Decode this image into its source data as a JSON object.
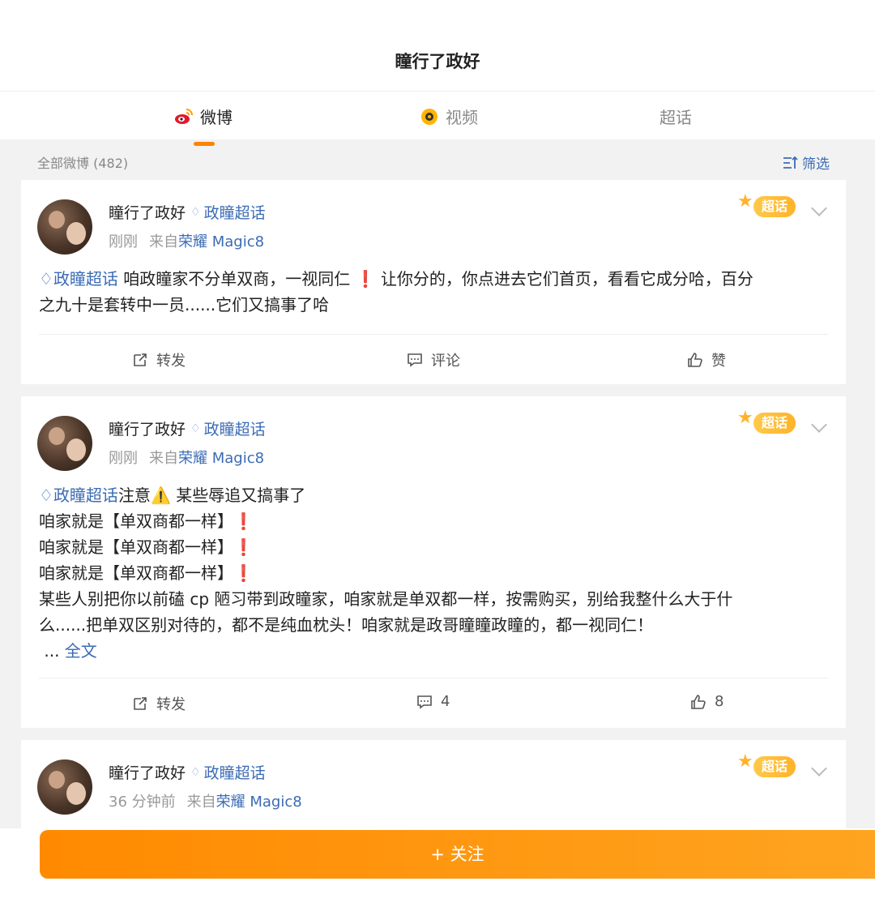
{
  "header": {
    "title": "瞳行了政好"
  },
  "tabs": [
    {
      "label": "微博",
      "icon": "weibo-icon"
    },
    {
      "label": "视频",
      "icon": "video-icon"
    },
    {
      "label": "超话",
      "icon": ""
    }
  ],
  "filter": {
    "count": "全部微博 (482)",
    "label": "筛选"
  },
  "posts": [
    {
      "username": "瞳行了政好",
      "topic": "政瞳超话",
      "time": "刚刚",
      "source": "来自",
      "device": "荣耀 Magic8",
      "badge": "超话",
      "text_topic": "政瞳超话",
      "text1": " 咱政瞳家不分单双商，一视同仁",
      "text_mark": "❗",
      "text2": " 让你分的，你点进去它们首页，看看它成分哈，百分",
      "text3": "之九十是套转中一员......它们又搞事了哈",
      "repost": "转发",
      "comment": "评论",
      "like": "赞"
    },
    {
      "username": "瞳行了政好",
      "topic": "政瞳超话",
      "time": "刚刚",
      "source": "来自",
      "device": "荣耀 Magic8",
      "badge": "超话",
      "text_topic": "政瞳超话",
      "line1": "注意",
      "line1_warn": "⚠️",
      "line1_tail": " 某些辱追又搞事了",
      "line2": "咱家就是【单双商都一样】",
      "mark": "❗",
      "line5": "某些人别把你以前磕 cp 陋习带到政瞳家，咱家就是单双都一样，按需购买，别给我整什么大于什",
      "line6": "么......把单双区别对待的，都不是纯血枕头！咱家就是政哥瞳瞳政瞳的，都一视同仁！",
      "more_prefix": "...",
      "more": "全文",
      "repost": "转发",
      "comment": "4",
      "like": "8"
    },
    {
      "username": "瞳行了政好",
      "topic": "政瞳超话",
      "time": "36 分钟前",
      "source": "来自",
      "device": "荣耀 Magic8",
      "badge": "超话"
    }
  ],
  "follow": {
    "label": "+ 关注"
  },
  "colors": {
    "accent": "#ff8200",
    "link": "#3b6bb5",
    "warning_red": "#e0201b"
  }
}
